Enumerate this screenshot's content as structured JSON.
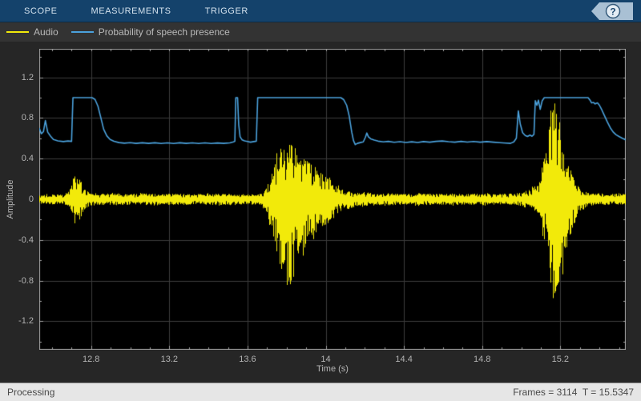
{
  "toolbar": {
    "tabs": [
      {
        "label": "SCOPE"
      },
      {
        "label": "MEASUREMENTS"
      },
      {
        "label": "TRIGGER"
      }
    ],
    "help_glyph": "?",
    "background": "#14426b"
  },
  "legend": {
    "items": [
      {
        "label": "Audio",
        "color": "#f2ea0a"
      },
      {
        "label": "Probability of speech presence",
        "color": "#4ba2dd"
      }
    ]
  },
  "status_bar": {
    "left": "Processing",
    "right": "Frames = 3114  T = 15.5347",
    "frames": 3114,
    "time": 15.5347
  },
  "chart_data": {
    "type": "line",
    "xlabel": "Time (s)",
    "ylabel": "Amplitude",
    "xlim": [
      12.5347,
      15.5347
    ],
    "ylim": [
      -1.48,
      1.48
    ],
    "x_ticks": [
      12.8,
      13.2,
      13.6,
      14,
      14.4,
      14.8,
      15.2
    ],
    "x_tick_labels": [
      "12.8",
      "13.2",
      "13.6",
      "14",
      "14.4",
      "14.8",
      "15.2"
    ],
    "y_ticks": [
      -1.2,
      -0.8,
      -0.4,
      0,
      0.4,
      0.8,
      1.2
    ],
    "y_tick_labels": [
      "-1.2",
      "-0.8",
      "-0.4",
      "0",
      "0.4",
      "0.8",
      "1.2"
    ],
    "x_minor_step": 0.1,
    "y_minor_step": 0.2,
    "grid": true,
    "background": "#000000",
    "grid_color": "#3c3c3c",
    "axis_color": "#a6a6a6",
    "tick_label_color": "#b2b2b2",
    "noise_seed": 13,
    "series": [
      {
        "name": "Audio",
        "type": "noise-envelope",
        "color": "#f2ea0a",
        "envelope": [
          [
            12.5347,
            0.045,
            0.045
          ],
          [
            12.6,
            0.05,
            0.05
          ],
          [
            12.655,
            0.045,
            0.045
          ],
          [
            12.675,
            0.06,
            0.06
          ],
          [
            12.695,
            0.12,
            0.1
          ],
          [
            12.71,
            0.26,
            0.2
          ],
          [
            12.722,
            0.2,
            0.3
          ],
          [
            12.735,
            0.22,
            0.24
          ],
          [
            12.75,
            0.15,
            0.18
          ],
          [
            12.765,
            0.1,
            0.1
          ],
          [
            12.79,
            0.065,
            0.065
          ],
          [
            12.85,
            0.055,
            0.055
          ],
          [
            12.93,
            0.06,
            0.06
          ],
          [
            13.0,
            0.052,
            0.052
          ],
          [
            13.08,
            0.06,
            0.06
          ],
          [
            13.16,
            0.052,
            0.052
          ],
          [
            13.25,
            0.058,
            0.058
          ],
          [
            13.34,
            0.052,
            0.052
          ],
          [
            13.43,
            0.058,
            0.058
          ],
          [
            13.52,
            0.052,
            0.052
          ],
          [
            13.6,
            0.05,
            0.05
          ],
          [
            13.655,
            0.055,
            0.055
          ],
          [
            13.685,
            0.08,
            0.09
          ],
          [
            13.705,
            0.17,
            0.22
          ],
          [
            13.73,
            0.32,
            0.42
          ],
          [
            13.755,
            0.46,
            0.58
          ],
          [
            13.78,
            0.58,
            0.75
          ],
          [
            13.8,
            0.6,
            0.85
          ],
          [
            13.82,
            0.57,
            0.88
          ],
          [
            13.84,
            0.52,
            0.75
          ],
          [
            13.865,
            0.46,
            0.6
          ],
          [
            13.89,
            0.4,
            0.48
          ],
          [
            13.92,
            0.36,
            0.4
          ],
          [
            13.955,
            0.3,
            0.32
          ],
          [
            13.99,
            0.24,
            0.27
          ],
          [
            14.03,
            0.18,
            0.2
          ],
          [
            14.07,
            0.13,
            0.14
          ],
          [
            14.11,
            0.09,
            0.1
          ],
          [
            14.15,
            0.065,
            0.075
          ],
          [
            14.2,
            0.075,
            0.065
          ],
          [
            14.25,
            0.055,
            0.055
          ],
          [
            14.32,
            0.06,
            0.06
          ],
          [
            14.4,
            0.053,
            0.053
          ],
          [
            14.48,
            0.06,
            0.06
          ],
          [
            14.56,
            0.053,
            0.053
          ],
          [
            14.64,
            0.058,
            0.058
          ],
          [
            14.72,
            0.052,
            0.052
          ],
          [
            14.8,
            0.058,
            0.058
          ],
          [
            14.88,
            0.052,
            0.052
          ],
          [
            14.96,
            0.058,
            0.058
          ],
          [
            15.0,
            0.065,
            0.065
          ],
          [
            15.03,
            0.09,
            0.08
          ],
          [
            15.06,
            0.12,
            0.1
          ],
          [
            15.09,
            0.18,
            0.15
          ],
          [
            15.11,
            0.42,
            0.35
          ],
          [
            15.13,
            0.55,
            0.5
          ],
          [
            15.145,
            0.95,
            0.75
          ],
          [
            15.158,
            1.0,
            0.98
          ],
          [
            15.175,
            0.97,
            0.98
          ],
          [
            15.19,
            0.85,
            0.95
          ],
          [
            15.205,
            0.65,
            0.75
          ],
          [
            15.22,
            0.5,
            0.58
          ],
          [
            15.24,
            0.35,
            0.42
          ],
          [
            15.26,
            0.25,
            0.3
          ],
          [
            15.28,
            0.16,
            0.2
          ],
          [
            15.3,
            0.1,
            0.12
          ],
          [
            15.33,
            0.075,
            0.085
          ],
          [
            15.37,
            0.06,
            0.06
          ],
          [
            15.45,
            0.055,
            0.055
          ],
          [
            15.5347,
            0.055,
            0.055
          ]
        ]
      },
      {
        "name": "Probability of speech presence",
        "type": "line",
        "color": "#4ba2dd",
        "points": [
          [
            12.5347,
            0.7
          ],
          [
            12.545,
            0.645
          ],
          [
            12.556,
            0.665
          ],
          [
            12.566,
            0.775
          ],
          [
            12.578,
            0.66
          ],
          [
            12.592,
            0.622
          ],
          [
            12.607,
            0.588
          ],
          [
            12.63,
            0.575
          ],
          [
            12.658,
            0.568
          ],
          [
            12.682,
            0.574
          ],
          [
            12.7,
            0.57
          ],
          [
            12.707,
            1.0
          ],
          [
            12.805,
            1.0
          ],
          [
            12.82,
            0.982
          ],
          [
            12.835,
            0.915
          ],
          [
            12.85,
            0.8
          ],
          [
            12.864,
            0.69
          ],
          [
            12.88,
            0.625
          ],
          [
            12.897,
            0.588
          ],
          [
            12.917,
            0.57
          ],
          [
            12.942,
            0.558
          ],
          [
            12.97,
            0.552
          ],
          [
            13.0,
            0.557
          ],
          [
            13.03,
            0.55
          ],
          [
            13.062,
            0.556
          ],
          [
            13.094,
            0.55
          ],
          [
            13.126,
            0.556
          ],
          [
            13.158,
            0.549
          ],
          [
            13.19,
            0.555
          ],
          [
            13.222,
            0.549
          ],
          [
            13.254,
            0.556
          ],
          [
            13.286,
            0.55
          ],
          [
            13.318,
            0.555
          ],
          [
            13.35,
            0.549
          ],
          [
            13.382,
            0.555
          ],
          [
            13.414,
            0.549
          ],
          [
            13.446,
            0.554
          ],
          [
            13.478,
            0.55
          ],
          [
            13.51,
            0.555
          ],
          [
            13.528,
            0.565
          ],
          [
            13.535,
            0.57
          ],
          [
            13.54,
            1.0
          ],
          [
            13.549,
            1.0
          ],
          [
            13.555,
            0.73
          ],
          [
            13.562,
            0.615
          ],
          [
            13.572,
            0.585
          ],
          [
            13.585,
            0.574
          ],
          [
            13.6,
            0.569
          ],
          [
            13.615,
            0.562
          ],
          [
            13.632,
            0.568
          ],
          [
            13.645,
            0.572
          ],
          [
            13.652,
            1.0
          ],
          [
            13.75,
            1.0
          ],
          [
            13.85,
            1.0
          ],
          [
            13.95,
            1.0
          ],
          [
            14.05,
            1.0
          ],
          [
            14.077,
            1.0
          ],
          [
            14.092,
            0.98
          ],
          [
            14.107,
            0.925
          ],
          [
            14.12,
            0.82
          ],
          [
            14.133,
            0.66
          ],
          [
            14.142,
            0.578
          ],
          [
            14.151,
            0.538
          ],
          [
            14.162,
            0.55
          ],
          [
            14.177,
            0.558
          ],
          [
            14.192,
            0.565
          ],
          [
            14.203,
            0.61
          ],
          [
            14.21,
            0.652
          ],
          [
            14.218,
            0.615
          ],
          [
            14.23,
            0.595
          ],
          [
            14.248,
            0.582
          ],
          [
            14.268,
            0.572
          ],
          [
            14.295,
            0.565
          ],
          [
            14.32,
            0.57
          ],
          [
            14.35,
            0.561
          ],
          [
            14.38,
            0.567
          ],
          [
            14.41,
            0.559
          ],
          [
            14.44,
            0.566
          ],
          [
            14.47,
            0.559
          ],
          [
            14.5,
            0.568
          ],
          [
            14.532,
            0.562
          ],
          [
            14.564,
            0.57
          ],
          [
            14.596,
            0.574
          ],
          [
            14.628,
            0.567
          ],
          [
            14.66,
            0.562
          ],
          [
            14.692,
            0.57
          ],
          [
            14.724,
            0.563
          ],
          [
            14.756,
            0.569
          ],
          [
            14.79,
            0.562
          ],
          [
            14.824,
            0.568
          ],
          [
            14.858,
            0.562
          ],
          [
            14.89,
            0.557
          ],
          [
            14.92,
            0.553
          ],
          [
            14.945,
            0.55
          ],
          [
            14.962,
            0.565
          ],
          [
            14.975,
            0.6
          ],
          [
            14.985,
            0.87
          ],
          [
            14.995,
            0.74
          ],
          [
            15.007,
            0.655
          ],
          [
            15.02,
            0.628
          ],
          [
            15.032,
            0.618
          ],
          [
            15.045,
            0.632
          ],
          [
            15.055,
            0.62
          ],
          [
            15.065,
            0.638
          ],
          [
            15.072,
            0.97
          ],
          [
            15.08,
            0.925
          ],
          [
            15.088,
            0.975
          ],
          [
            15.097,
            0.885
          ],
          [
            15.107,
            0.968
          ],
          [
            15.118,
            1.0
          ],
          [
            15.19,
            1.0
          ],
          [
            15.27,
            1.0
          ],
          [
            15.342,
            1.0
          ],
          [
            15.352,
            0.975
          ],
          [
            15.36,
            0.948
          ],
          [
            15.37,
            0.952
          ],
          [
            15.378,
            0.938
          ],
          [
            15.39,
            0.948
          ],
          [
            15.4,
            0.925
          ],
          [
            15.412,
            0.88
          ],
          [
            15.425,
            0.825
          ],
          [
            15.44,
            0.762
          ],
          [
            15.455,
            0.705
          ],
          [
            15.47,
            0.662
          ],
          [
            15.485,
            0.635
          ],
          [
            15.5,
            0.618
          ],
          [
            15.517,
            0.6
          ],
          [
            15.5347,
            0.585
          ]
        ]
      }
    ]
  }
}
